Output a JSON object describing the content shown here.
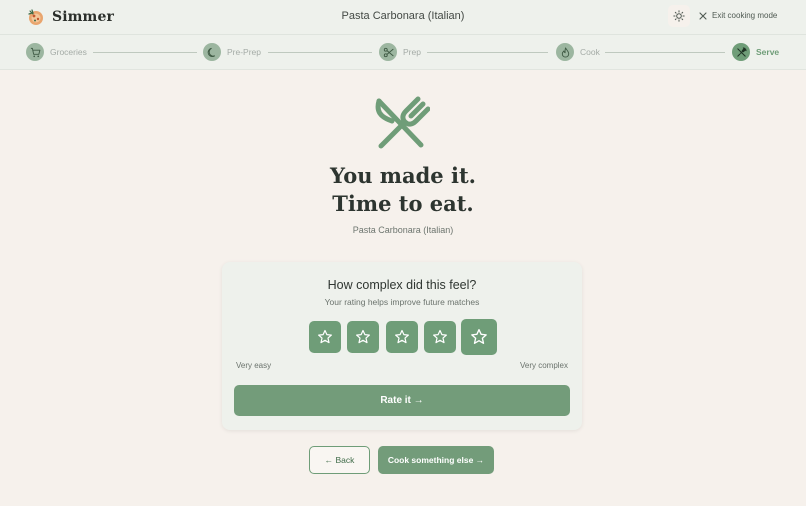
{
  "header": {
    "brand": "Simmer",
    "title": "Pasta Carbonara (Italian)",
    "theme_icon": "sun-icon",
    "exit_label": "Exit cooking mode"
  },
  "stepper": {
    "steps": [
      {
        "label": "Groceries",
        "icon": "cart-icon",
        "active": false
      },
      {
        "label": "Pre-Prep",
        "icon": "moon-icon",
        "active": false
      },
      {
        "label": "Prep",
        "icon": "scissors-icon",
        "active": false
      },
      {
        "label": "Cook",
        "icon": "flame-icon",
        "active": false
      },
      {
        "label": "Serve",
        "icon": "utensils-icon",
        "active": true
      }
    ]
  },
  "hero": {
    "title_line1": "You made it.",
    "title_line2": "Time to eat.",
    "subtitle": "Pasta Carbonara (Italian)"
  },
  "rating": {
    "question": "How complex did this feel?",
    "hint": "Your rating helps improve future matches",
    "star_count": 5,
    "selected": 5,
    "scale_low": "Very easy",
    "scale_high": "Very complex",
    "submit_label": "Rate it →"
  },
  "actions": {
    "back_label": "← Back",
    "cook_again_label": "Cook something else →"
  },
  "colors": {
    "accent": "#6f9d78",
    "background": "#f6f1ec",
    "header": "#eef1ec"
  }
}
